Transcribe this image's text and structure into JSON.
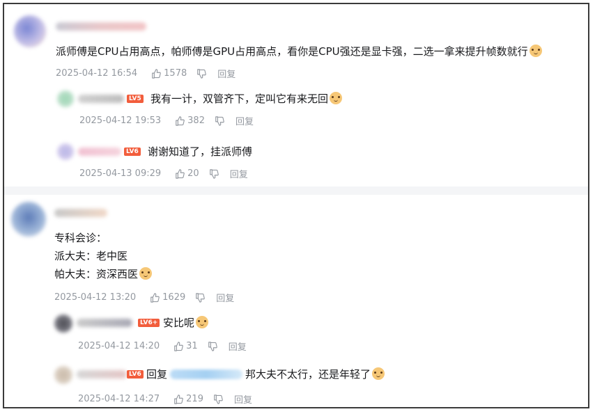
{
  "threads": [
    {
      "comment": {
        "text": "派师傅是CPU占用高点，帕师傅是GPU占用高点，看你是CPU强还是显卡强，二选一拿来提升帧数就行",
        "emoji": "doge-icon",
        "date": "2025-04-12 16:54",
        "likes": "1578",
        "reply_label": "回复"
      },
      "replies": [
        {
          "level": "LV5",
          "text": "我有一计，双管齐下，定叫它有来无回",
          "emoji": "doge-icon",
          "date": "2025-04-12 19:53",
          "likes": "382",
          "reply_label": "回复"
        },
        {
          "level": "LV6",
          "text": "谢谢知道了，挂派师傅",
          "date": "2025-04-13 09:29",
          "likes": "20",
          "reply_label": "回复"
        }
      ]
    },
    {
      "comment": {
        "lines": [
          "专科会诊：",
          "派大夫：老中医",
          "帕大夫：资深西医"
        ],
        "emoji": "doge-icon",
        "date": "2025-04-12 13:20",
        "likes": "1629",
        "reply_label": "回复"
      },
      "replies": [
        {
          "level": "LV6+",
          "text": "安比呢",
          "emoji": "doge-icon",
          "date": "2025-04-12 14:20",
          "likes": "31",
          "reply_label": "回复"
        },
        {
          "level": "LV6",
          "prefix": "回复",
          "text": "邦大夫不太行，还是年轻了",
          "emoji": "doge-icon",
          "date": "2025-04-12 14:27",
          "likes": "219",
          "reply_label": "回复"
        }
      ]
    }
  ]
}
